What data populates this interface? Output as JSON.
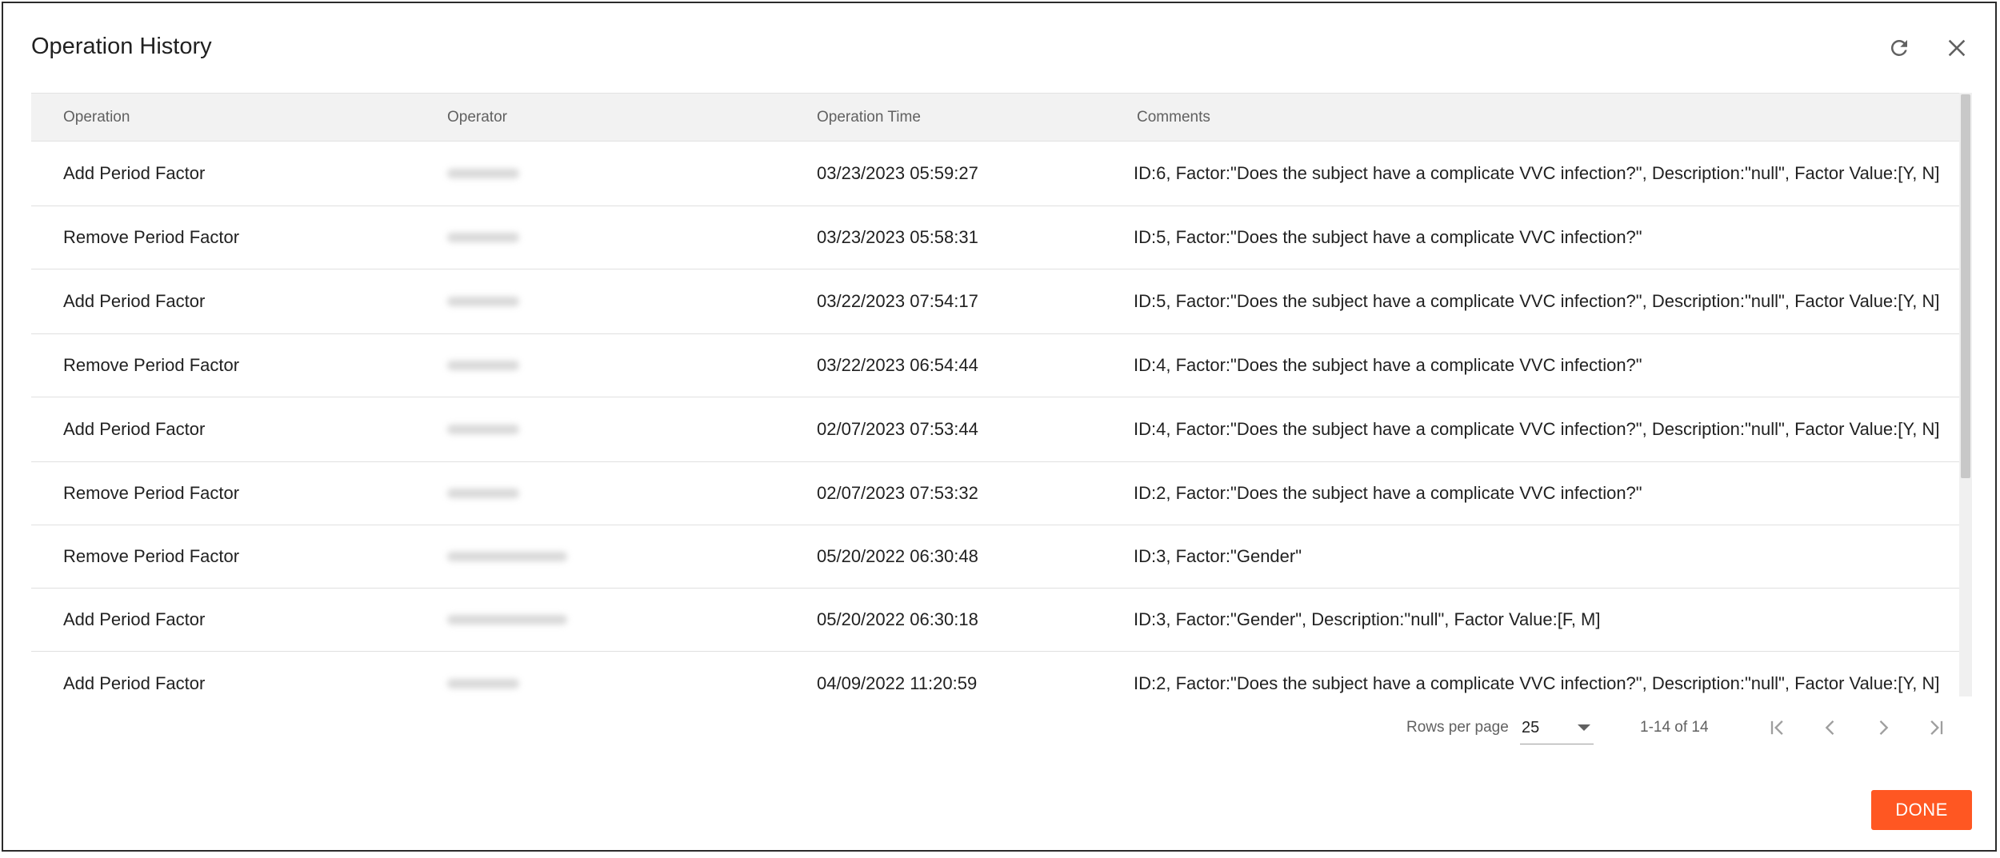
{
  "dialog": {
    "title": "Operation History",
    "refresh_icon": "refresh-icon",
    "close_icon": "close-icon"
  },
  "table": {
    "columns": [
      "Operation",
      "Operator",
      "Operation Time",
      "Comments"
    ],
    "rows": [
      {
        "operation": "Add Period Factor",
        "time": "03/23/2023 05:59:27",
        "comments": "ID:6, Factor:\"Does the subject have a complicate VVC infection?\", Description:\"null\", Factor Value:[Y, N]"
      },
      {
        "operation": "Remove Period Factor",
        "time": "03/23/2023 05:58:31",
        "comments": "ID:5, Factor:\"Does the subject have a complicate VVC infection?\""
      },
      {
        "operation": "Add Period Factor",
        "time": "03/22/2023 07:54:17",
        "comments": "ID:5, Factor:\"Does the subject have a complicate VVC infection?\", Description:\"null\", Factor Value:[Y, N]"
      },
      {
        "operation": "Remove Period Factor",
        "time": "03/22/2023 06:54:44",
        "comments": "ID:4, Factor:\"Does the subject have a complicate VVC infection?\""
      },
      {
        "operation": "Add Period Factor",
        "time": "02/07/2023 07:53:44",
        "comments": "ID:4, Factor:\"Does the subject have a complicate VVC infection?\", Description:\"null\", Factor Value:[Y, N]"
      },
      {
        "operation": "Remove Period Factor",
        "time": "02/07/2023 07:53:32",
        "comments": "ID:2, Factor:\"Does the subject have a complicate VVC infection?\""
      },
      {
        "operation": "Remove Period Factor",
        "time": "05/20/2022 06:30:48",
        "comments": "ID:3, Factor:\"Gender\""
      },
      {
        "operation": "Add Period Factor",
        "time": "05/20/2022 06:30:18",
        "comments": "ID:3, Factor:\"Gender\", Description:\"null\", Factor Value:[F, M]"
      },
      {
        "operation": "Add Period Factor",
        "time": "04/09/2022 11:20:59",
        "comments": "ID:2, Factor:\"Does the subject have a complicate VVC infection?\", Description:\"null\", Factor Value:[Y, N]"
      }
    ]
  },
  "pagination": {
    "rows_per_page_label": "Rows per page",
    "rows_per_page_value": "25",
    "range": "1-14 of 14",
    "first_icon": "first-page-icon",
    "prev_icon": "chevron-left-icon",
    "next_icon": "chevron-right-icon",
    "last_icon": "last-page-icon"
  },
  "footer": {
    "done_label": "DONE",
    "done_color": "#ff5722"
  }
}
